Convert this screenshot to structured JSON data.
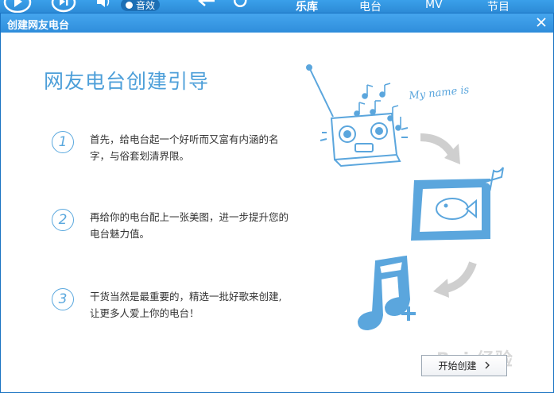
{
  "background_app": {
    "effects_label": "音效",
    "nav": [
      "乐库",
      "电台",
      "MV",
      "节目"
    ]
  },
  "dialog": {
    "title": "创建网友电台",
    "heading": "网友电台创建引导",
    "steps": [
      {
        "number": "1",
        "text": "首先，给电台起一个好听而又富有内涵的名字，与俗套划清界限。"
      },
      {
        "number": "2",
        "text": "再给你的电台配上一张美图，进一步提升您的电台魅力值。"
      },
      {
        "number": "3",
        "text": "干货当然是最重要的，精选一批好歌来创建,让更多人爱上你的电台！"
      }
    ],
    "start_button": "开始创建",
    "illustration_text": "My name is",
    "watermark": "Bai 经验"
  },
  "colors": {
    "accent": "#4d9fd9",
    "titlebar": "#2f8ddb",
    "illustration": "#5ba6dd"
  }
}
